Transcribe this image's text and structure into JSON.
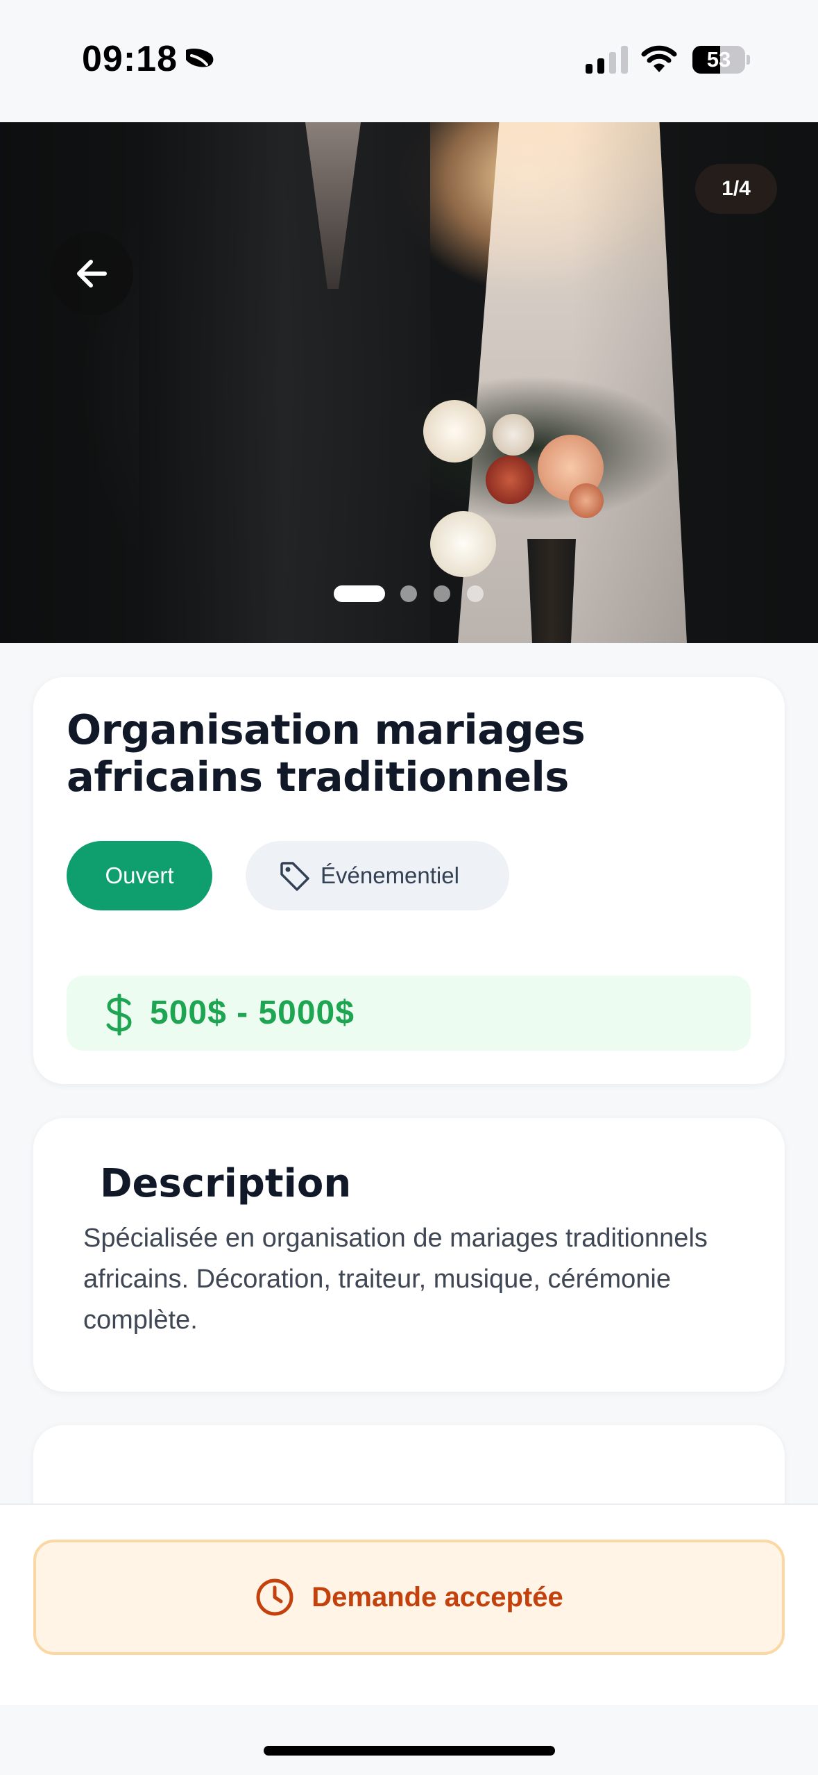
{
  "status_bar": {
    "time": "09:18",
    "battery_level": 53,
    "battery_text": "53",
    "icons": [
      "focus-moon-icon",
      "cellular-signal-icon",
      "wifi-icon",
      "battery-icon"
    ]
  },
  "gallery": {
    "counter": "1/4",
    "current_index": 1,
    "total": 4,
    "back_icon": "arrow-left-icon"
  },
  "listing": {
    "title": "Organisation mariages africains traditionnels",
    "status_badge": "Ouvert",
    "category": "Événementiel",
    "category_icon": "tag-icon",
    "price_icon": "dollar-icon",
    "price_range": "500$ - 5000$"
  },
  "description": {
    "heading": "Description",
    "text": "Spécialisée en organisation de mariages traditionnels africains. Décoration, traiteur, musique, cérémonie complète."
  },
  "action": {
    "label": "Demande acceptée",
    "icon": "clock-icon"
  },
  "colors": {
    "status_open": "#0f9f6e",
    "price_green": "#1ea552",
    "accepted_text": "#c2410c",
    "accepted_bg": "#fff4e6",
    "accepted_border": "#fbd7a3"
  }
}
